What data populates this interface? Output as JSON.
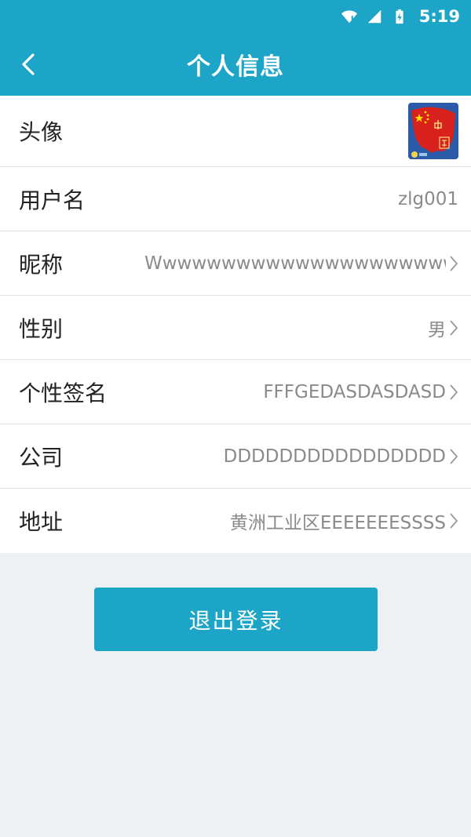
{
  "status_bar": {
    "time": "5:19",
    "icons": [
      "wifi-icon",
      "cell-signal-icon",
      "battery-charging-icon"
    ]
  },
  "header": {
    "title": "个人信息",
    "back_icon": "chevron-left-icon"
  },
  "profile": {
    "avatar_label": "头像",
    "rows": [
      {
        "label": "用户名",
        "value": "zlg001",
        "has_chevron": false
      },
      {
        "label": "昵称",
        "value": "Wwwwwwwwwwwwwwwwwwwwww",
        "has_chevron": true
      },
      {
        "label": "性别",
        "value": "男",
        "has_chevron": true
      },
      {
        "label": "个性签名",
        "value": "FFFGEDASDASDASD",
        "has_chevron": true
      },
      {
        "label": "公司",
        "value": "DDDDDDDDDDDDDDDD",
        "has_chevron": true
      },
      {
        "label": "地址",
        "value": "黄洲工业区EEEEEEESSSS",
        "has_chevron": true
      }
    ]
  },
  "actions": {
    "logout_label": "退出登录"
  },
  "colors": {
    "primary": "#1ca5c6",
    "background": "#eef1f3",
    "label_text": "#222222",
    "value_text": "#8a8a8a"
  }
}
